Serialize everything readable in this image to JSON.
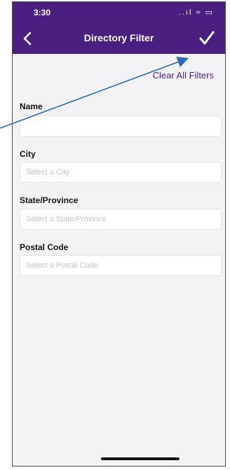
{
  "status": {
    "time": "3:30",
    "icons": "..ıl ≈ ▭"
  },
  "nav": {
    "title": "Directory Filter"
  },
  "actions": {
    "clear_all": "Clear All Filters"
  },
  "fields": [
    {
      "label": "Name",
      "placeholder": "",
      "value": ""
    },
    {
      "label": "City",
      "placeholder": "Select a City",
      "value": ""
    },
    {
      "label": "State/Province",
      "placeholder": "Select a State/Province",
      "value": ""
    },
    {
      "label": "Postal Code",
      "placeholder": "Select a Postal Code",
      "value": ""
    }
  ],
  "colors": {
    "header": "#4b1f7f",
    "accent": "#4b1f7f",
    "background": "#f3f3f5",
    "annotation_arrow": "#2f6db5"
  },
  "icons": {
    "back": "chevron-left-icon",
    "done": "checkmark-icon"
  }
}
